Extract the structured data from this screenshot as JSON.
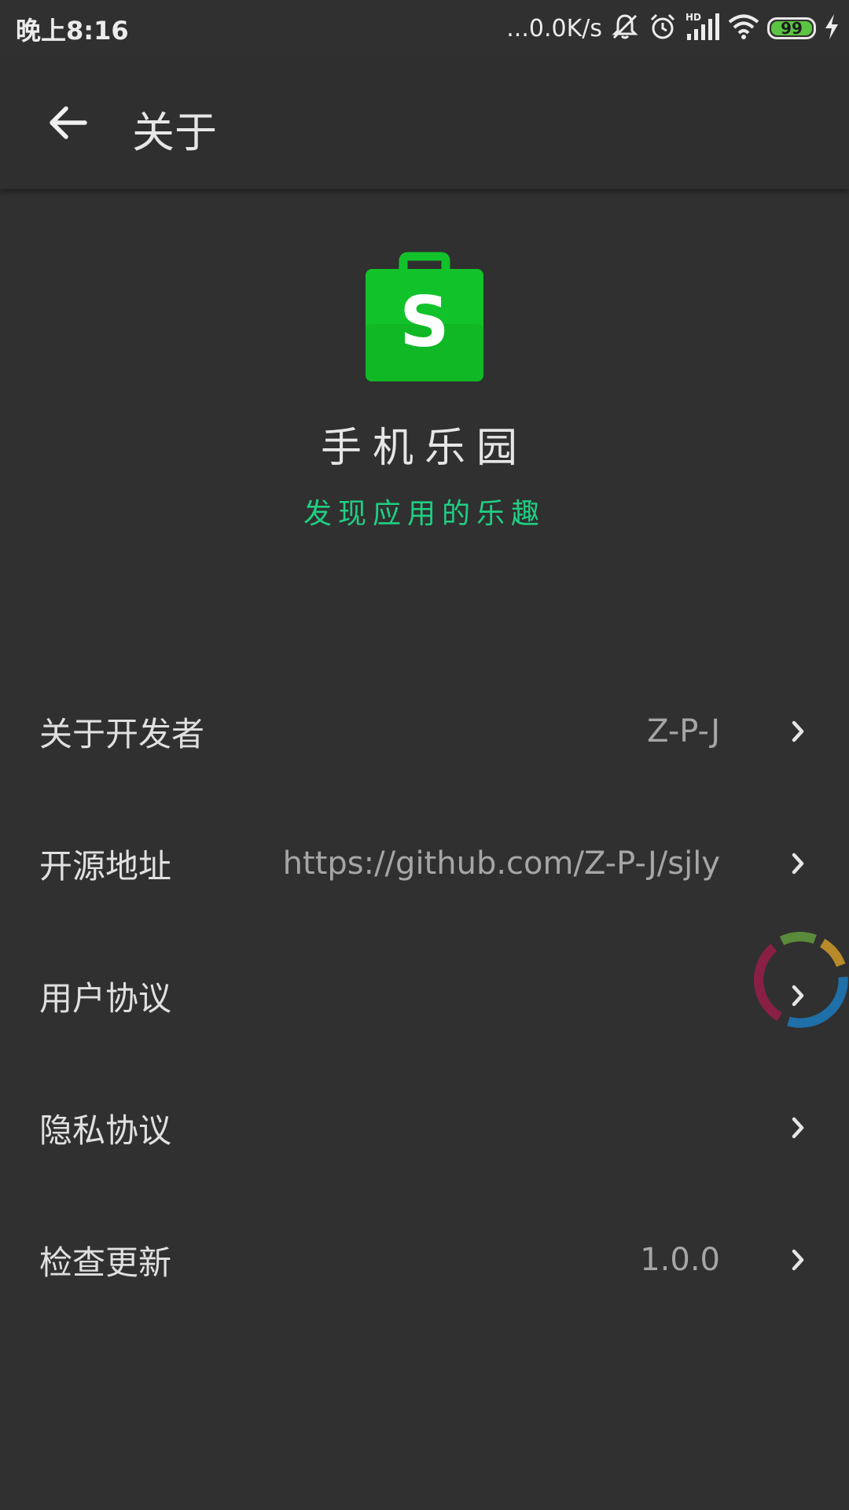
{
  "status_bar": {
    "time": "晚上8:16",
    "network_speed": "...0.0K/s",
    "network_badge": "HD",
    "battery_level": "99",
    "icons": [
      "mute-bell-icon",
      "alarm-icon",
      "signal-icon",
      "wifi-icon",
      "battery-icon",
      "charging-icon"
    ]
  },
  "app_bar": {
    "back_icon": "arrow-left-icon",
    "title": "关于"
  },
  "hero": {
    "logo_letter": "S",
    "logo_color": "#12c22a",
    "app_name": "手机乐园",
    "slogan": "发现应用的乐趣",
    "slogan_color": "#1fcf83"
  },
  "menu": {
    "items": [
      {
        "label": "关于开发者",
        "value": "Z-P-J"
      },
      {
        "label": "开源地址",
        "value": "https://github.com/Z-P-J/sjly"
      },
      {
        "label": "用户协议",
        "value": ""
      },
      {
        "label": "隐私协议",
        "value": ""
      },
      {
        "label": "检查更新",
        "value": "1.0.0"
      }
    ]
  },
  "floating_widget": {
    "icon": "loading-ring-icon",
    "colors": [
      "#5a8a3a",
      "#b88a2a",
      "#1f6fa8",
      "#8a1f46"
    ]
  }
}
